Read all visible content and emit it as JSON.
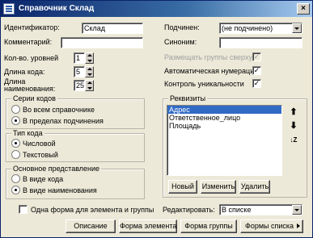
{
  "window": {
    "title": "Справочник Склад",
    "close_label": "×"
  },
  "left": {
    "identifier_label": "Идентификатор:",
    "identifier_value": "Склад",
    "comment_label": "Комментарий:",
    "comment_value": "",
    "levels_label": "Кол-во. уровней",
    "levels_value": "1",
    "code_length_label": "Длина кода:",
    "code_length_value": "5",
    "name_length_label_line1": "Длина",
    "name_length_label_line2": "наименования:",
    "name_length_value": "25"
  },
  "right": {
    "subordinate_label": "Подчинен:",
    "subordinate_value": "(не подчинено)",
    "synonym_label": "Синоним:",
    "synonym_value": "",
    "groups_top_label": "Размещать группы сверху",
    "auto_numbering_label": "Автоматическая нумерация",
    "uniqueness_label": "Контроль уникальности",
    "check_mark": "✓"
  },
  "code_series": {
    "title": "Серии кодов",
    "options": [
      "Во всем справочнике",
      "В пределах подчинения"
    ]
  },
  "code_type": {
    "title": "Тип кода",
    "options": [
      "Числовой",
      "Текстовый"
    ]
  },
  "main_view": {
    "title": "Основное представление",
    "options": [
      "В виде кода",
      "В виде наименования"
    ]
  },
  "attributes": {
    "title": "Реквизиты",
    "items": [
      "Адрес",
      "Ответственное_лицо",
      "Площадь"
    ],
    "new_label": "Новый",
    "edit_label": "Изменить",
    "delete_label": "Удалить",
    "up_icon": "⬆",
    "down_icon": "⬇",
    "sort_icon": "↓Z"
  },
  "bottom": {
    "one_form_label": "Одна форма для элемента и группы",
    "editing_label": "Редактировать:",
    "editing_value": "В списке",
    "description_label": "Описание",
    "element_form_label": "Форма элемента",
    "group_form_label": "Форма группы",
    "list_forms_label": "Формы списка"
  }
}
